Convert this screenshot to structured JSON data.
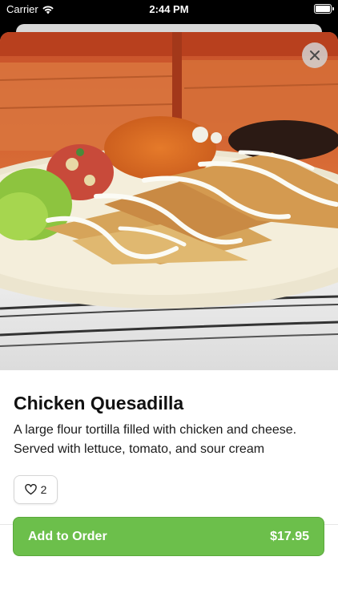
{
  "status_bar": {
    "carrier": "Carrier",
    "time": "2:44 PM",
    "icons": [
      "wifi-icon",
      "battery-icon"
    ]
  },
  "item": {
    "title": "Chicken Quesadilla",
    "description": "A large flour tortilla filled with chicken and cheese. Served with lettuce, tomato, and sour cream",
    "image_alt": "chicken-quesadilla-photo",
    "like_count": "2"
  },
  "actions": {
    "close_icon": "close-icon",
    "like_icon": "heart-icon",
    "add_label": "Add to Order",
    "price": "$17.95"
  },
  "colors": {
    "accent": "#6cbf4b",
    "close_bg": "#d2d2d2"
  }
}
